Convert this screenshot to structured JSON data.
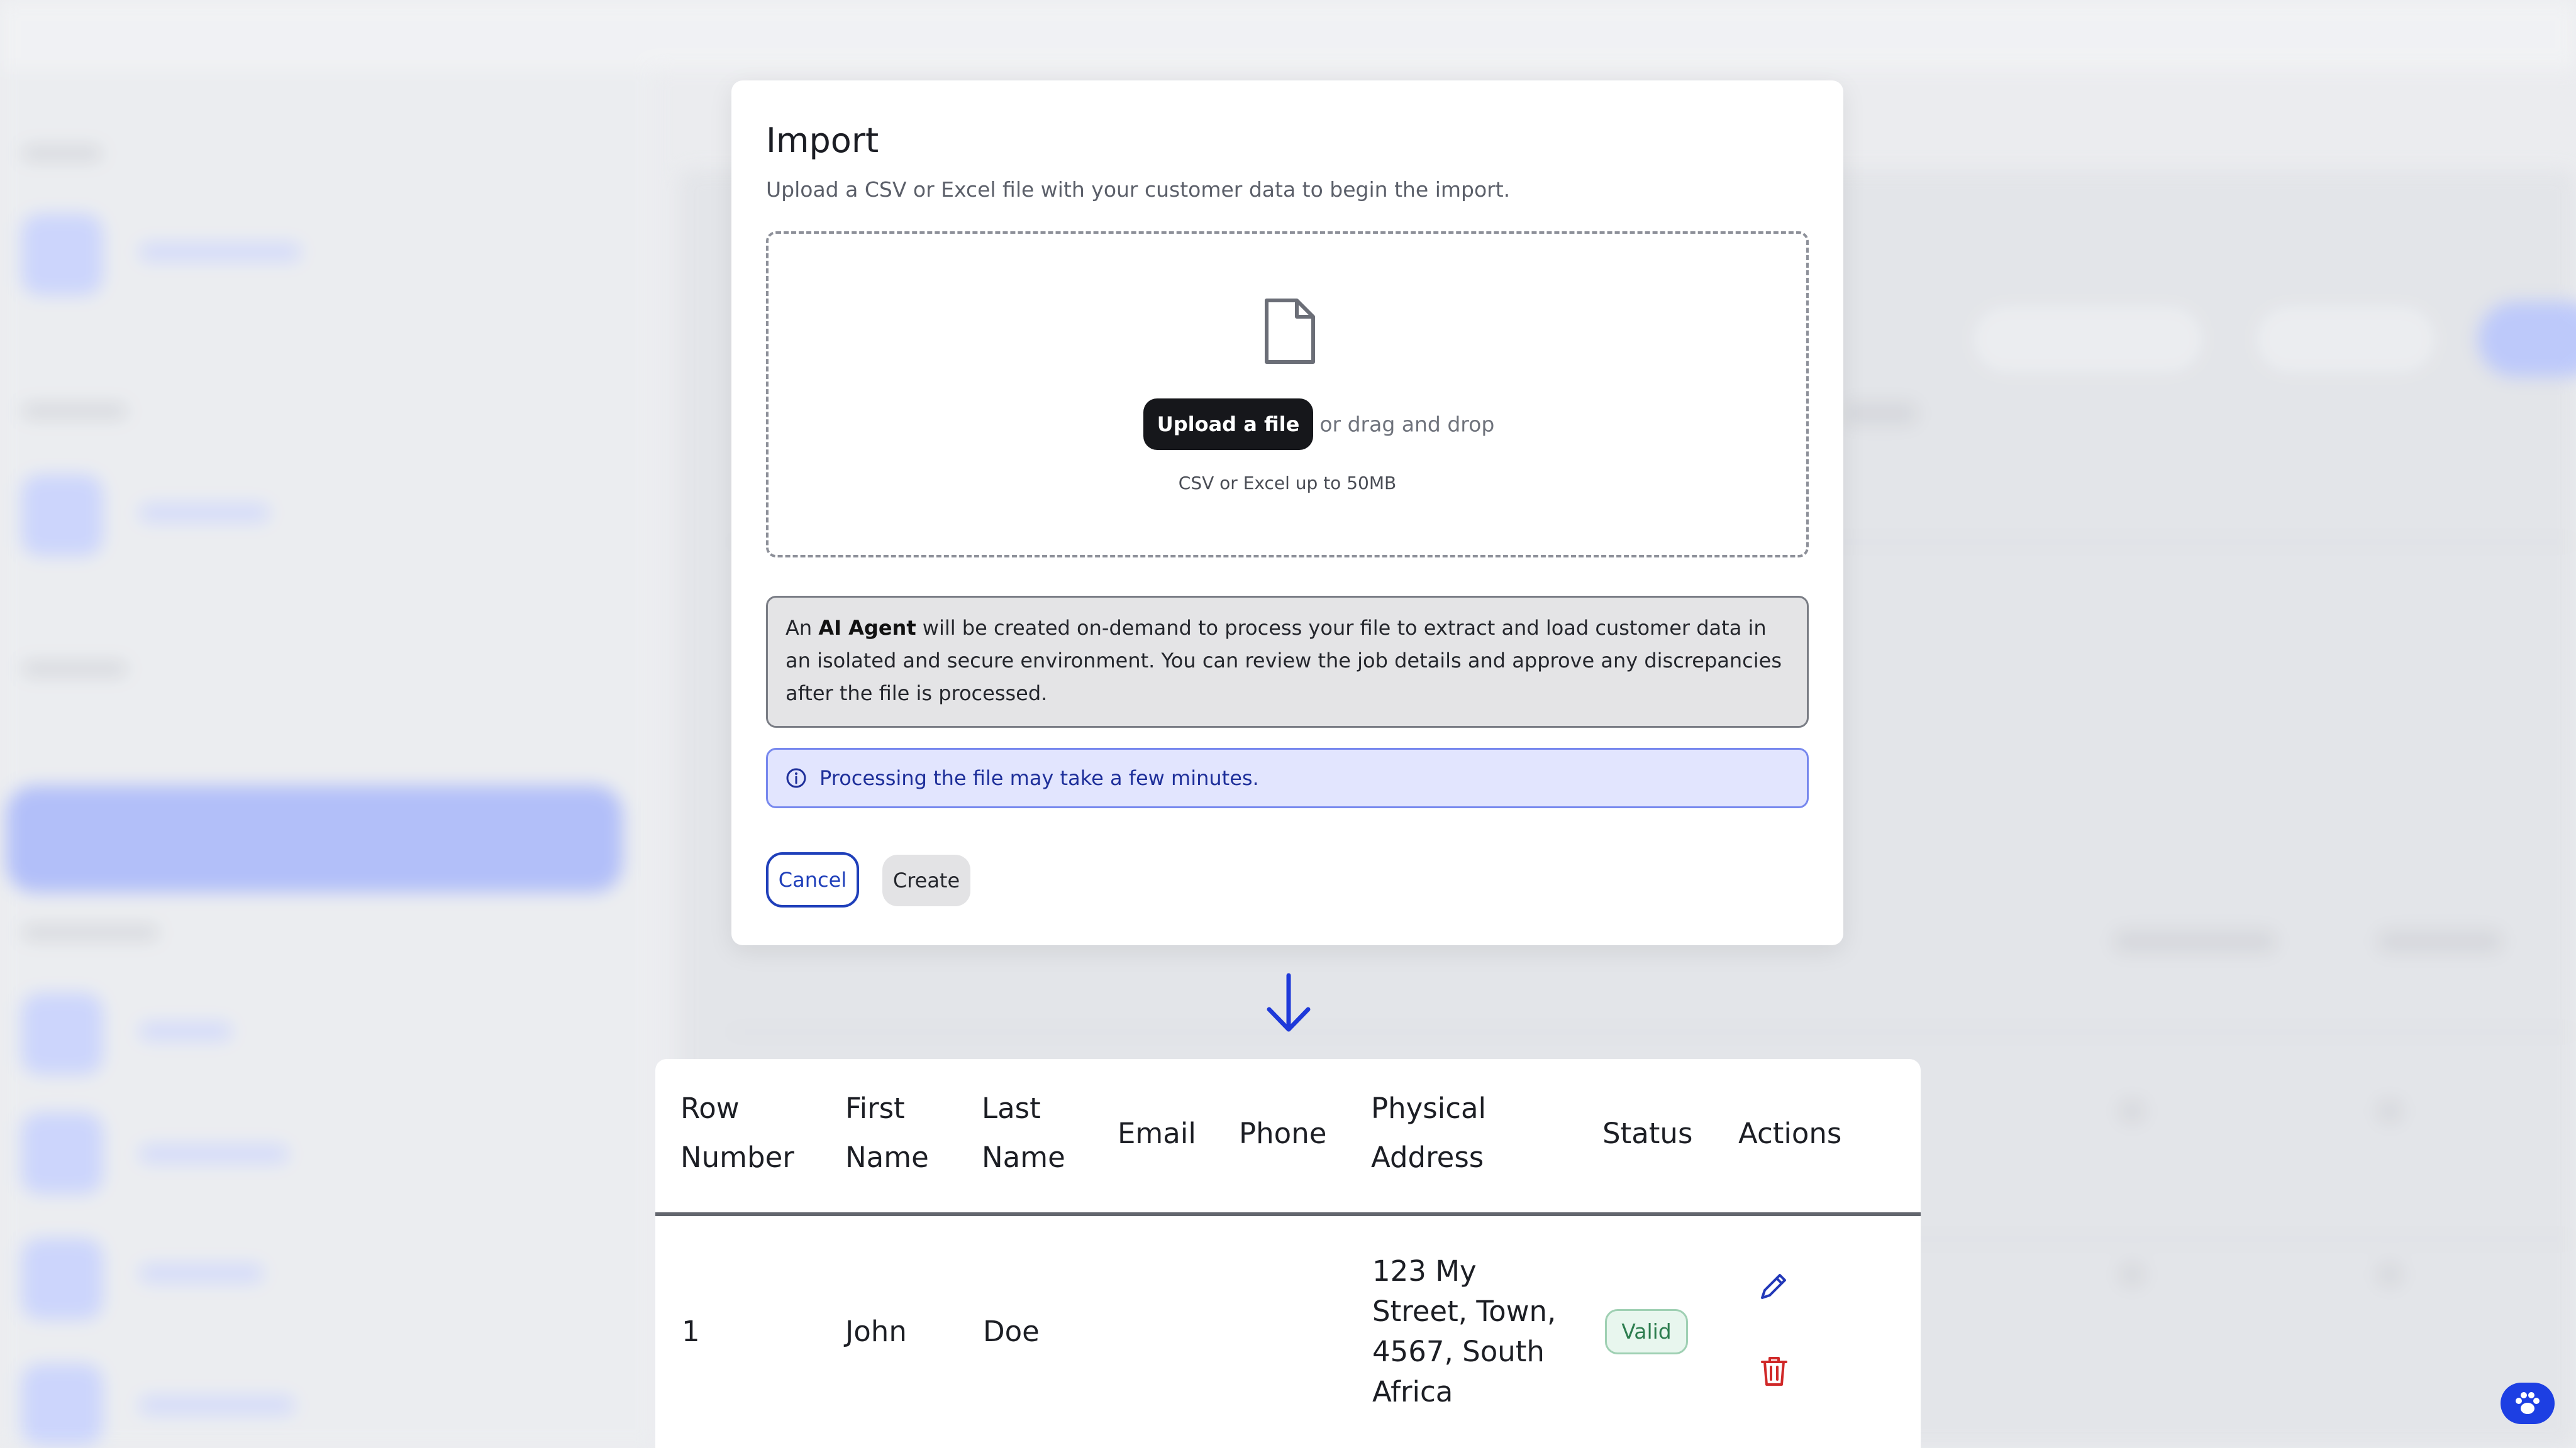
{
  "modal": {
    "title": "Import",
    "description": "Upload a CSV or Excel file with your customer data to begin the import.",
    "upload_button": "Upload a file",
    "drag_text": "or drag and drop",
    "file_hint": "CSV or Excel up to 50MB",
    "info_prefix": "An ",
    "info_bold": "AI Agent",
    "info_rest": " will be created on-demand to process your file to extract and load customer data in an isolated and secure environment. You can review the job details and approve any discrepancies after the file is processed.",
    "note": "Processing the file may take a few minutes.",
    "cancel_label": "Cancel",
    "create_label": "Create"
  },
  "table": {
    "columns": [
      {
        "line1": "Row",
        "line2": "Number"
      },
      {
        "line1": "First",
        "line2": "Name"
      },
      {
        "line1": "Last",
        "line2": "Name"
      },
      {
        "line1": "Email",
        "line2": ""
      },
      {
        "line1": "Phone",
        "line2": ""
      },
      {
        "line1": "Physical",
        "line2": "Address"
      },
      {
        "line1": "Status",
        "line2": ""
      },
      {
        "line1": "Actions",
        "line2": ""
      }
    ],
    "rows": [
      {
        "row_number": "1",
        "first_name": "John",
        "last_name": "Doe",
        "email": "",
        "phone": "",
        "address_lines": [
          "123 My",
          "Street, Town,",
          "4567, South",
          "Africa"
        ],
        "status": "Valid"
      }
    ]
  },
  "colors": {
    "accent": "#1f3fba",
    "note_bg": "#e2e5fe",
    "valid_green": "#2d7d4f",
    "delete_red": "#d02828"
  },
  "icons": {
    "file": "file-icon",
    "info": "info-circle-icon",
    "arrow": "arrow-down-icon",
    "edit": "pencil-icon",
    "delete": "trash-icon",
    "help": "paw-icon"
  }
}
